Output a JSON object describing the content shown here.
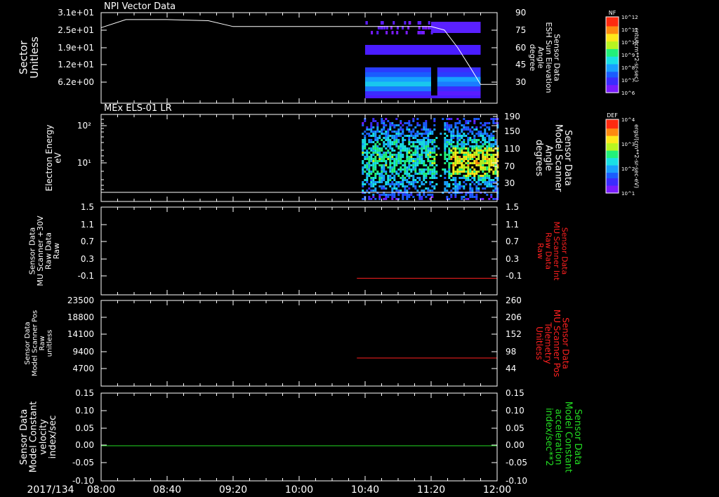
{
  "date_label": "2017/134",
  "time_ticks": [
    "08:00",
    "08:40",
    "09:20",
    "10:00",
    "10:40",
    "11:20",
    "12:00"
  ],
  "colors": {
    "background": "#000000",
    "axes": "#ffffff",
    "red_trace": "#ff2020",
    "green_trace": "#22dd22"
  },
  "chart_data": [
    {
      "id": "p1",
      "type": "heatmap",
      "title": "NPI Vector Data",
      "ylabel": [
        "Sector",
        "Unitless"
      ],
      "yticks": [
        "3.1e+01",
        "2.5e+01",
        "1.9e+01",
        "1.2e+01",
        "6.2e+00"
      ],
      "right_label": [
        "Sensor Data",
        "ESH Sun Elevation",
        "Angle",
        "degree"
      ],
      "right_ticks": [
        "90",
        "75",
        "60",
        "45",
        "30"
      ],
      "overlay_line": {
        "name": "Sun Elevation",
        "t": [
          "08:00",
          "08:15",
          "08:40",
          "09:05",
          "09:20",
          "10:00",
          "10:40",
          "11:20",
          "11:28",
          "11:36",
          "11:44",
          "11:50",
          "12:00"
        ],
        "deg": [
          77,
          84,
          84,
          83,
          78,
          78,
          78,
          78,
          75,
          60,
          42,
          28,
          28
        ]
      },
      "data_start": "10:40",
      "data_end": "11:50",
      "colorbar": {
        "label": "NF",
        "unit": "cnts/(cm**2-sr-sec)",
        "ticks": [
          "10^12",
          "10^11",
          "10^10",
          "10^9",
          "10^8",
          "10^7",
          "10^6"
        ]
      }
    },
    {
      "id": "p2",
      "type": "heatmap",
      "title": "MEx ELS-01 LR",
      "ylabel": [
        "Electron Energy",
        "eV"
      ],
      "yticks": [
        "10²",
        "10¹"
      ],
      "right_label": [
        "Sensor Data",
        "Model Scanner",
        "Angle",
        "degrees"
      ],
      "right_ticks": [
        "190",
        "150",
        "110",
        "70",
        "30"
      ],
      "overlay_line": {
        "name": "Scanner Angle",
        "t": [
          "08:00",
          "12:00"
        ],
        "deg": [
          10,
          10
        ]
      },
      "data_start": "10:38",
      "data_end": "12:00",
      "colorbar": {
        "label": "DEF",
        "unit": "ergs/(cm**2-sr-sec-eV)",
        "ticks": [
          "10^4",
          "10^3",
          "10^2",
          "10^1"
        ]
      }
    },
    {
      "id": "p3",
      "type": "line",
      "ylabel": [
        "Sensor Data",
        "MU Scanner +30V",
        "Raw Data",
        "Raw"
      ],
      "yticks": [
        "1.5",
        "1.1",
        "0.7",
        "0.3",
        "-0.1"
      ],
      "ylim": [
        -0.35,
        1.5
      ],
      "right_label": [
        "Sensor Data",
        "MU Scanner Int",
        "Raw Data",
        "Raw"
      ],
      "right_ticks": [
        "1.5",
        "1.1",
        "0.7",
        "0.3",
        "-0.1"
      ],
      "series": [
        {
          "t": [
            "10:35",
            "12:00"
          ],
          "y": [
            0.0,
            0.0
          ],
          "color": "red"
        }
      ]
    },
    {
      "id": "p4",
      "type": "line",
      "ylabel": [
        "Sensor Data",
        "Model Scanner Pos",
        "Raw",
        "unitless"
      ],
      "yticks": [
        "23500",
        "18800",
        "14100",
        "9400",
        "4700"
      ],
      "ylim": [
        0,
        23500
      ],
      "right_label": [
        "Sensor Data",
        "MU Scanner Pos",
        "Telemetry",
        "Unitless"
      ],
      "right_ticks": [
        "260",
        "206",
        "152",
        "98",
        "44"
      ],
      "series": [
        {
          "t": [
            "10:35",
            "12:00"
          ],
          "y": [
            7700,
            7700
          ],
          "color": "red"
        }
      ]
    },
    {
      "id": "p5",
      "type": "line",
      "ylabel": [
        "Sensor Data",
        "Model Constant",
        "velocity",
        "index/sec"
      ],
      "yticks": [
        "0.15",
        "0.10",
        "0.05",
        "0.00",
        "-0.05",
        "-0.10"
      ],
      "ylim": [
        -0.1,
        0.15
      ],
      "right_label": [
        "Sensor Data",
        "Model Constant",
        "acceleration",
        "index/sec**2"
      ],
      "right_ticks": [
        "0.15",
        "0.10",
        "0.05",
        "0.00",
        "-0.05",
        "-0.10"
      ],
      "series": [
        {
          "t": [
            "08:00",
            "12:00"
          ],
          "y": [
            0.0,
            0.0
          ],
          "color": "green"
        }
      ]
    }
  ]
}
